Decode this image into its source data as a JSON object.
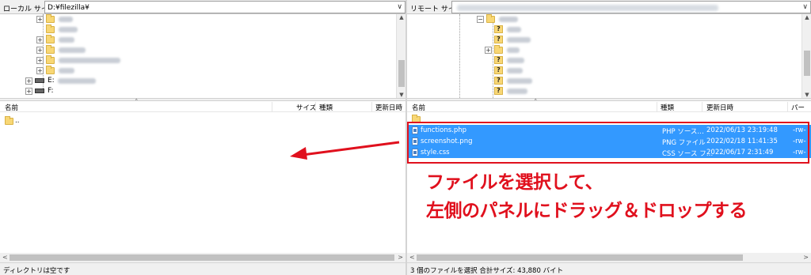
{
  "left": {
    "site_label": "ローカル サイト:",
    "site_value": "D:¥filezilla¥",
    "drives": [
      "E:",
      "F:"
    ],
    "columns": {
      "name": "名前",
      "size": "サイズ",
      "type": "種類",
      "modified": "更新日時"
    },
    "parent_entry": "..",
    "status": "ディレクトリは空です"
  },
  "right": {
    "site_label": "リモート サイト:",
    "columns": {
      "name": "名前",
      "type": "種類",
      "modified": "更新日時",
      "perm": "パーミッ"
    },
    "files": [
      {
        "name": "functions.php",
        "type": "PHP ソース…",
        "modified": "2022/06/13 23:19:48",
        "perm": "-rw-"
      },
      {
        "name": "screenshot.png",
        "type": "PNG ファイル",
        "modified": "2022/02/18 11:41:35",
        "perm": "-rw-"
      },
      {
        "name": "style.css",
        "type": "CSS ソース フ…",
        "modified": "2022/06/17 2:31:49",
        "perm": "-rw-"
      }
    ],
    "status": "3 個のファイルを選択 合計サイズ: 43,880 バイト"
  },
  "annotation": {
    "line1": "ファイルを選択して、",
    "line2": "左側のパネルにドラッグ＆ドロップする"
  },
  "colors": {
    "accent_red": "#e0101d",
    "selection_blue": "#3399ff"
  }
}
